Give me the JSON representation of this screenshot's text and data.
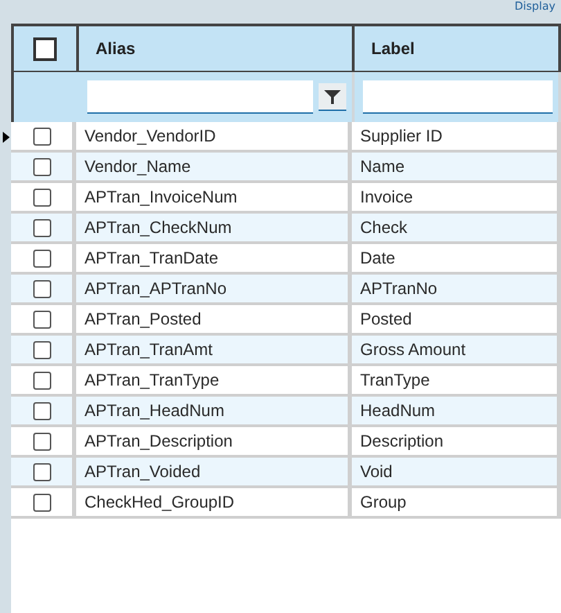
{
  "top_link": "Display",
  "header": {
    "select_all_checked": false,
    "columns": [
      "Alias",
      "Label"
    ]
  },
  "filters": [
    {
      "kind": "with_button"
    },
    {
      "kind": "plain"
    }
  ],
  "rows": [
    {
      "alias": "Vendor_VendorID",
      "label": "Supplier ID",
      "checked": false,
      "current": true
    },
    {
      "alias": "Vendor_Name",
      "label": "Name",
      "checked": false,
      "current": false
    },
    {
      "alias": "APTran_InvoiceNum",
      "label": "Invoice",
      "checked": false,
      "current": false
    },
    {
      "alias": "APTran_CheckNum",
      "label": "Check",
      "checked": false,
      "current": false
    },
    {
      "alias": "APTran_TranDate",
      "label": "Date",
      "checked": false,
      "current": false
    },
    {
      "alias": "APTran_APTranNo",
      "label": "APTranNo",
      "checked": false,
      "current": false
    },
    {
      "alias": "APTran_Posted",
      "label": "Posted",
      "checked": false,
      "current": false
    },
    {
      "alias": "APTran_TranAmt",
      "label": "Gross Amount",
      "checked": false,
      "current": false
    },
    {
      "alias": "APTran_TranType",
      "label": "TranType",
      "checked": false,
      "current": false
    },
    {
      "alias": "APTran_HeadNum",
      "label": "HeadNum",
      "checked": false,
      "current": false
    },
    {
      "alias": "APTran_Description",
      "label": "Description",
      "checked": false,
      "current": false
    },
    {
      "alias": "APTran_Voided",
      "label": "Void",
      "checked": false,
      "current": false
    },
    {
      "alias": "CheckHed_GroupID",
      "label": "Group",
      "checked": false,
      "current": false
    }
  ]
}
